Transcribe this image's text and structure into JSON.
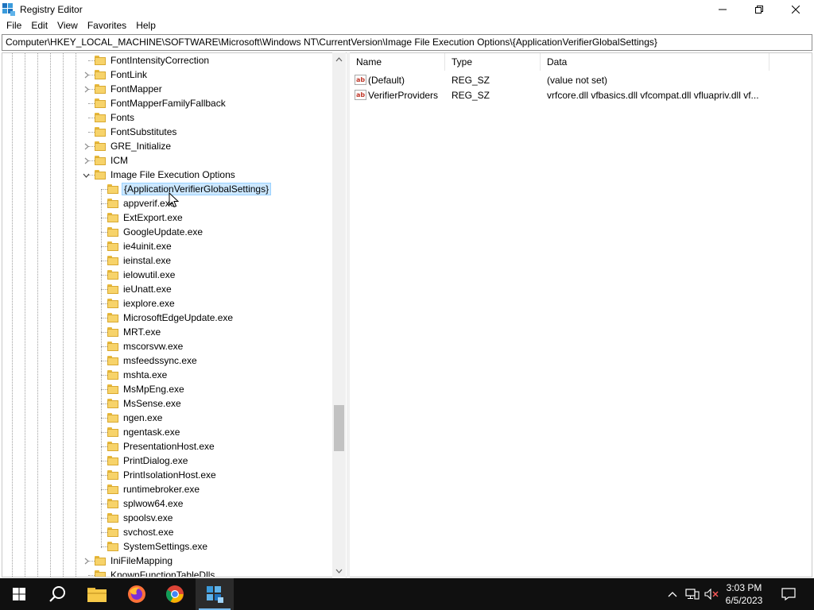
{
  "window": {
    "title": "Registry Editor",
    "controls": {
      "minimize": "minimize",
      "restore": "restore",
      "close": "close"
    }
  },
  "menu": [
    "File",
    "Edit",
    "View",
    "Favorites",
    "Help"
  ],
  "address": "Computer\\HKEY_LOCAL_MACHINE\\SOFTWARE\\Microsoft\\Windows NT\\CurrentVersion\\Image File Execution Options\\{ApplicationVerifierGlobalSettings}",
  "tree": {
    "parent_items": [
      {
        "label": "FontIntensityCorrection",
        "expandable": false
      },
      {
        "label": "FontLink",
        "expandable": true
      },
      {
        "label": "FontMapper",
        "expandable": true
      },
      {
        "label": "FontMapperFamilyFallback",
        "expandable": false
      },
      {
        "label": "Fonts",
        "expandable": false
      },
      {
        "label": "FontSubstitutes",
        "expandable": false
      },
      {
        "label": "GRE_Initialize",
        "expandable": true
      },
      {
        "label": "ICM",
        "expandable": true
      },
      {
        "label": "Image File Execution Options",
        "expandable": true,
        "expanded": true
      }
    ],
    "child_items": [
      {
        "label": "{ApplicationVerifierGlobalSettings}",
        "selected": true
      },
      {
        "label": "appverif.exe"
      },
      {
        "label": "ExtExport.exe"
      },
      {
        "label": "GoogleUpdate.exe"
      },
      {
        "label": "ie4uinit.exe"
      },
      {
        "label": "ieinstal.exe"
      },
      {
        "label": "ielowutil.exe"
      },
      {
        "label": "ieUnatt.exe"
      },
      {
        "label": "iexplore.exe"
      },
      {
        "label": "MicrosoftEdgeUpdate.exe"
      },
      {
        "label": "MRT.exe"
      },
      {
        "label": "mscorsvw.exe"
      },
      {
        "label": "msfeedssync.exe"
      },
      {
        "label": "mshta.exe"
      },
      {
        "label": "MsMpEng.exe"
      },
      {
        "label": "MsSense.exe"
      },
      {
        "label": "ngen.exe"
      },
      {
        "label": "ngentask.exe"
      },
      {
        "label": "PresentationHost.exe"
      },
      {
        "label": "PrintDialog.exe"
      },
      {
        "label": "PrintIsolationHost.exe"
      },
      {
        "label": "runtimebroker.exe"
      },
      {
        "label": "splwow64.exe"
      },
      {
        "label": "spoolsv.exe"
      },
      {
        "label": "svchost.exe"
      },
      {
        "label": "SystemSettings.exe"
      }
    ],
    "after_items": [
      {
        "label": "IniFileMapping",
        "expandable": true
      },
      {
        "label": "KnownFunctionTableDlls",
        "expandable": false
      }
    ]
  },
  "values": {
    "headers": {
      "name": "Name",
      "type": "Type",
      "data": "Data"
    },
    "rows": [
      {
        "icon": "ab",
        "name": "(Default)",
        "type": "REG_SZ",
        "data": "(value not set)"
      },
      {
        "icon": "ab",
        "name": "VerifierProviders",
        "type": "REG_SZ",
        "data": "vrfcore.dll vfbasics.dll vfcompat.dll vfluapriv.dll vf..."
      }
    ]
  },
  "taskbar": {
    "icons": [
      "windows-start-icon",
      "search-icon",
      "file-explorer-icon",
      "firefox-icon",
      "chrome-icon",
      "regedit-icon"
    ],
    "time": "3:03 PM",
    "date": "6/5/2023"
  },
  "colors": {
    "selection_bg": "#cce8ff",
    "folder": "#f7d36a",
    "taskbar": "#101010",
    "taskbar_active_indicator": "#76b9ed"
  }
}
